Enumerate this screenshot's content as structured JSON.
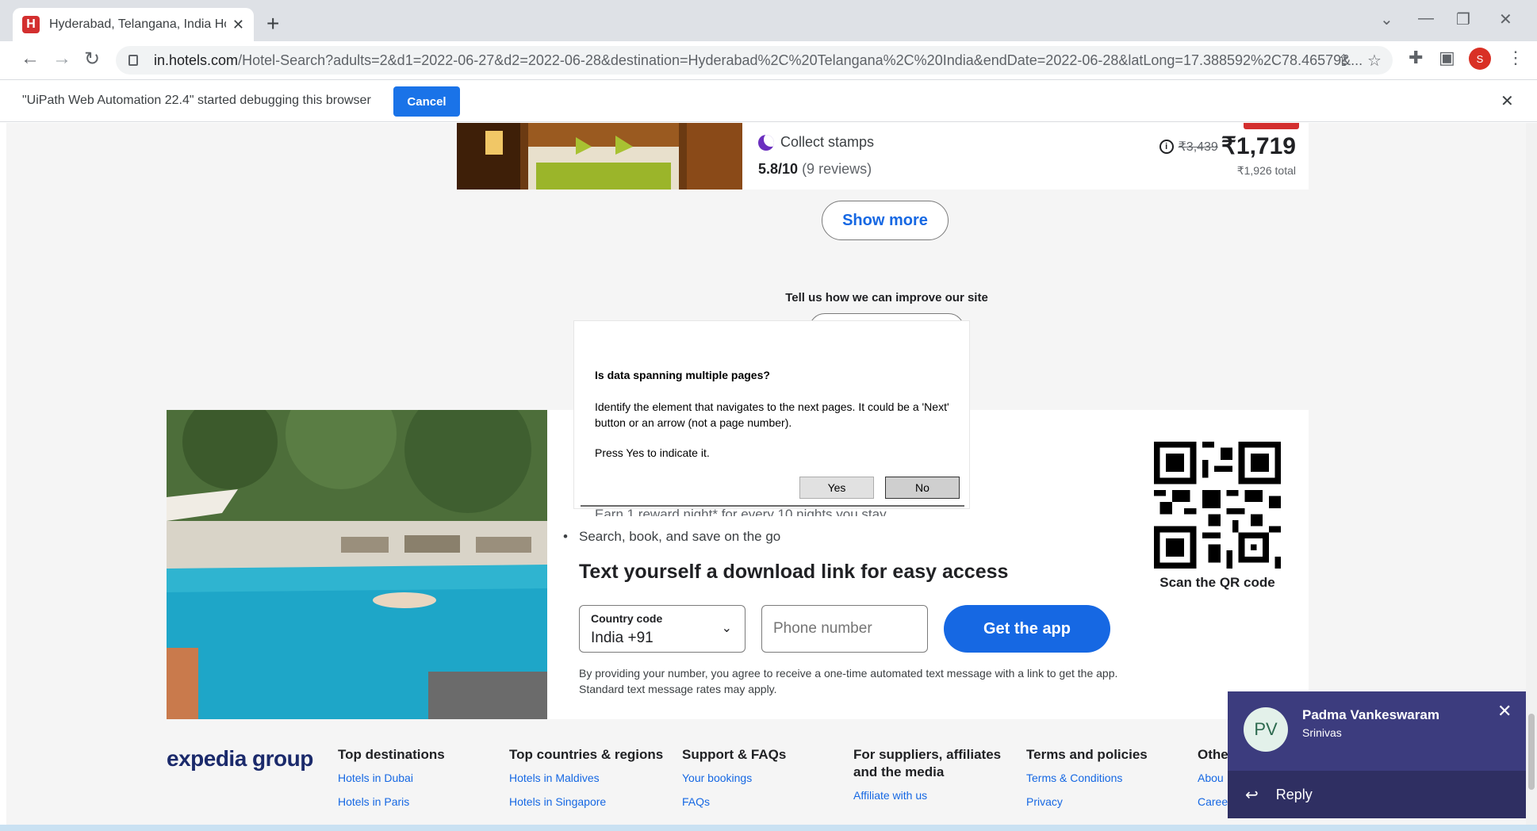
{
  "browser": {
    "tab_title": "Hyderabad, Telangana, India Hot",
    "url_host": "in.hotels.com",
    "url_rest": "/Hotel-Search?adults=2&d1=2022-06-27&d2=2022-06-28&destination=Hyderabad%2C%20Telangana%2C%20India&endDate=2022-06-28&latLong=17.388592%2C78.46579&...",
    "profile_initial": "S"
  },
  "infobar": {
    "message": "\"UiPath Web Automation 22.4\" started debugging this browser",
    "cancel_label": "Cancel"
  },
  "hotel": {
    "stamps": "Collect stamps",
    "rating": "5.8/10",
    "reviews": "(9 reviews)",
    "old_price": "₹3,439",
    "price": "₹1,719",
    "total": "₹1,926 total"
  },
  "show_more": "Show more",
  "feedback": "Tell us how we can improve our site",
  "app_promo": {
    "partial_bullet": "Earn 1 reward night* for every 10 nights you stay",
    "bullet": "Search, book, and save on the go",
    "title": "Text yourself a download link for easy access",
    "country_label": "Country code",
    "country_value": "India +91",
    "phone_placeholder": "Phone number",
    "get_app": "Get the app",
    "disclaimer": "By providing your number, you agree to receive a one-time automated text message with a link to get the app. Standard text message rates may apply.",
    "qr_label": "Scan the QR code"
  },
  "footer": {
    "brand": "expedia group",
    "columns": [
      {
        "title": "Top destinations",
        "links": [
          "Hotels in Dubai",
          "Hotels in Paris"
        ]
      },
      {
        "title": "Top countries & regions",
        "links": [
          "Hotels in Maldives",
          "Hotels in Singapore"
        ]
      },
      {
        "title": "Support & FAQs",
        "links": [
          "Your bookings",
          "FAQs"
        ]
      },
      {
        "title": "For suppliers, affiliates and the media",
        "links": [
          "Affiliate with us"
        ]
      },
      {
        "title": "Terms and policies",
        "links": [
          "Terms & Conditions",
          "Privacy"
        ]
      },
      {
        "title": "Othe",
        "links": [
          "Abou",
          "Careers"
        ]
      }
    ]
  },
  "dialog": {
    "question": "Is data spanning multiple pages?",
    "text": "Identify the element that navigates to the next pages. It could be a 'Next' button or an arrow (not a page number).",
    "press": "Press Yes to indicate it.",
    "yes": "Yes",
    "no": "No"
  },
  "toast": {
    "initials": "PV",
    "name": "Padma Vankeswaram",
    "subtitle": "Srinivas",
    "reply": "Reply"
  },
  "colors": {
    "brand_blue": "#1668e3",
    "chrome_blue": "#1a73e8",
    "hotels_red": "#d32f2f",
    "teams_purple": "#3c3c7e"
  }
}
